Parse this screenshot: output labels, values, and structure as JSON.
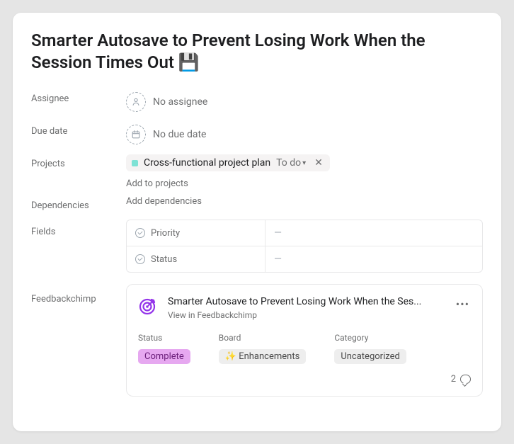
{
  "title": "Smarter Autosave to Prevent Losing Work When the Session Times Out 💾",
  "labels": {
    "assignee": "Assignee",
    "due_date": "Due date",
    "projects": "Projects",
    "dependencies": "Dependencies",
    "fields": "Fields",
    "feedbackchimp": "Feedbackchimp"
  },
  "assignee": {
    "empty_text": "No assignee"
  },
  "due_date": {
    "empty_text": "No due date"
  },
  "projects": {
    "chip_name": "Cross-functional project plan",
    "chip_status": "To do",
    "add_link": "Add to projects"
  },
  "dependencies": {
    "add_link": "Add dependencies"
  },
  "fields": {
    "rows": [
      {
        "name": "Priority",
        "value": "—"
      },
      {
        "name": "Status",
        "value": "—"
      }
    ]
  },
  "feedbackchimp": {
    "title": "Smarter Autosave to Prevent Losing Work When the Ses...",
    "view_link": "View in Feedbackchimp",
    "meta": {
      "status_label": "Status",
      "status_value": "Complete",
      "board_label": "Board",
      "board_value": "✨ Enhancements",
      "category_label": "Category",
      "category_value": "Uncategorized"
    },
    "comments": "2"
  }
}
